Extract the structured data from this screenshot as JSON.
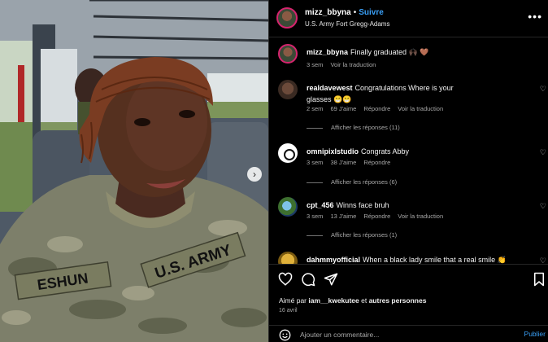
{
  "post": {
    "username": "mizz_bbyna",
    "follow_label": "Suivre",
    "location": "U.S. Army Fort Gregg-Adams",
    "photo": {
      "name_tape": "ESHUN",
      "branch_tape": "U.S. ARMY"
    }
  },
  "caption": {
    "username": "mizz_bbyna",
    "text": "Finally graduated 🙌🏿 🤎",
    "time": "3 sem",
    "translate": "Voir la traduction"
  },
  "comments": [
    {
      "username": "realdavewest",
      "text": "Congratulations Where is your glasses 😁😁",
      "time": "2 sem",
      "likes": "69 J'aime",
      "reply": "Répondre",
      "translate": "Voir la traduction",
      "replies": "Afficher les réponses (11)"
    },
    {
      "username": "omnipixlstudio",
      "text": "Congrats Abby",
      "time": "3 sem",
      "likes": "38 J'aime",
      "reply": "Répondre",
      "translate": "",
      "replies": "Afficher les réponses (6)"
    },
    {
      "username": "cpt_456",
      "text": "Winns face bruh",
      "time": "3 sem",
      "likes": "13 J'aime",
      "reply": "Répondre",
      "translate": "Voir la traduction",
      "replies": "Afficher les réponses (1)"
    },
    {
      "username": "dahmmyofficial",
      "text": "When a black lady smile that a real smile 👏",
      "time": "",
      "likes": "",
      "reply": "",
      "translate": "",
      "replies": ""
    }
  ],
  "footer": {
    "liked_by_prefix": "Aimé par ",
    "liked_by_user": "iam__kwekutee",
    "liked_by_suffix": " et ",
    "liked_by_others": "autres personnes",
    "date": "16 avril",
    "comment_placeholder": "Ajouter un commentaire...",
    "publish_label": "Publier"
  },
  "icons": {
    "like": "heart-icon",
    "comment": "comment-icon",
    "share": "share-icon",
    "save": "bookmark-icon",
    "more": "more-icon",
    "emoji": "emoji-icon",
    "next": "chevron-right-icon"
  },
  "colors": {
    "accent": "#3aa0f7",
    "background": "#000000",
    "muted_text": "#a8a8a8"
  }
}
